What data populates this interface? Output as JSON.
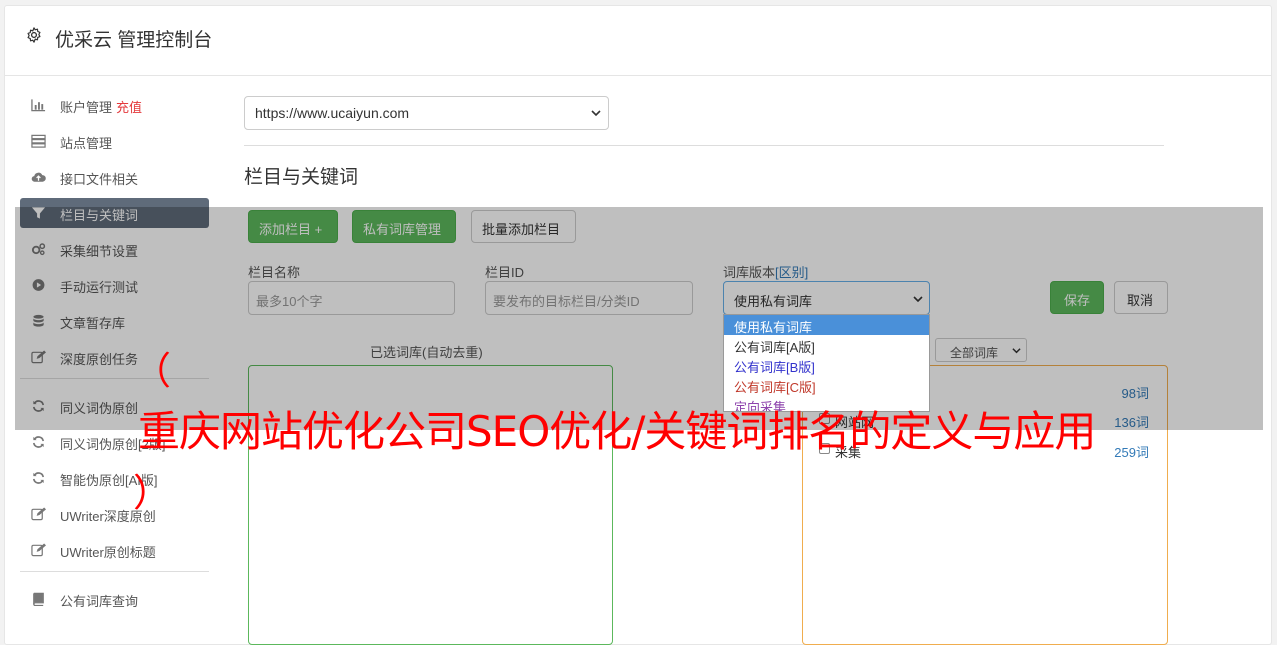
{
  "header": {
    "title": "优采云 管理控制台",
    "icon": "gear-icon"
  },
  "sidebar": {
    "items": [
      {
        "label": "账户管理",
        "extra": "充值",
        "icon": "bar-chart-icon"
      },
      {
        "label": "站点管理",
        "icon": "server-icon"
      },
      {
        "label": "接口文件相关",
        "icon": "cloud-upload-icon"
      },
      {
        "label": "栏目与关键词",
        "icon": "filter-icon",
        "active": true
      },
      {
        "label": "采集细节设置",
        "icon": "cogs-icon"
      },
      {
        "label": "手动运行测试",
        "icon": "play-circle-icon"
      },
      {
        "label": "文章暂存库",
        "icon": "database-icon"
      },
      {
        "label": "深度原创任务",
        "icon": "edit-icon"
      },
      {
        "label": "同义词伪原创",
        "icon": "refresh-icon"
      },
      {
        "label": "同义词伪原创[2版]",
        "icon": "refresh-icon"
      },
      {
        "label": "智能伪原创[AI版]",
        "icon": "refresh-icon"
      },
      {
        "label": "UWriter深度原创",
        "icon": "edit-icon"
      },
      {
        "label": "UWriter原创标题",
        "icon": "edit-icon"
      },
      {
        "label": "公有词库查询",
        "icon": "book-icon"
      }
    ]
  },
  "main": {
    "site_select": "https://www.ucaiyun.com",
    "section_title": "栏目与关键词",
    "buttons": {
      "add_column": "添加栏目 +",
      "private_lib": "私有词库管理",
      "batch_add": "批量添加栏目",
      "save": "保存",
      "cancel": "取消"
    },
    "fields": {
      "column_name_label": "栏目名称",
      "column_name_placeholder": "最多10个字",
      "column_id_label": "栏目ID",
      "column_id_placeholder": "要发布的目标栏目/分类ID",
      "lib_version_label": "词库版本",
      "lib_version_link": "[区别]",
      "lib_version_value": "使用私有词库"
    },
    "dropdown_options": [
      {
        "label": "使用私有词库",
        "color": "#ffffff",
        "selected": true
      },
      {
        "label": "公有词库[A版]",
        "color": "#333333"
      },
      {
        "label": "公有词库[B版]",
        "color": "#3333cc"
      },
      {
        "label": "公有词库[C版]",
        "color": "#c0392b"
      },
      {
        "label": "定向采集",
        "color": "#8e44ad"
      }
    ],
    "selected_panel_title": "已选词库(自动去重)",
    "all_lib_select": "全部词库",
    "lib_rows": [
      {
        "name": "",
        "count": "98词"
      },
      {
        "name": "网站网",
        "count": "136词"
      },
      {
        "name": "采集",
        "count": "259词"
      }
    ]
  },
  "overlay": {
    "open_paren": "（",
    "text": "重庆网站优化公司SEO优化/关键词排名的定义与应用",
    "close_paren": "）"
  },
  "colors": {
    "green": "#5cb85c",
    "active_nav": "#5f6b7a",
    "link": "#337ab7",
    "overlay_text": "#ff0000"
  }
}
